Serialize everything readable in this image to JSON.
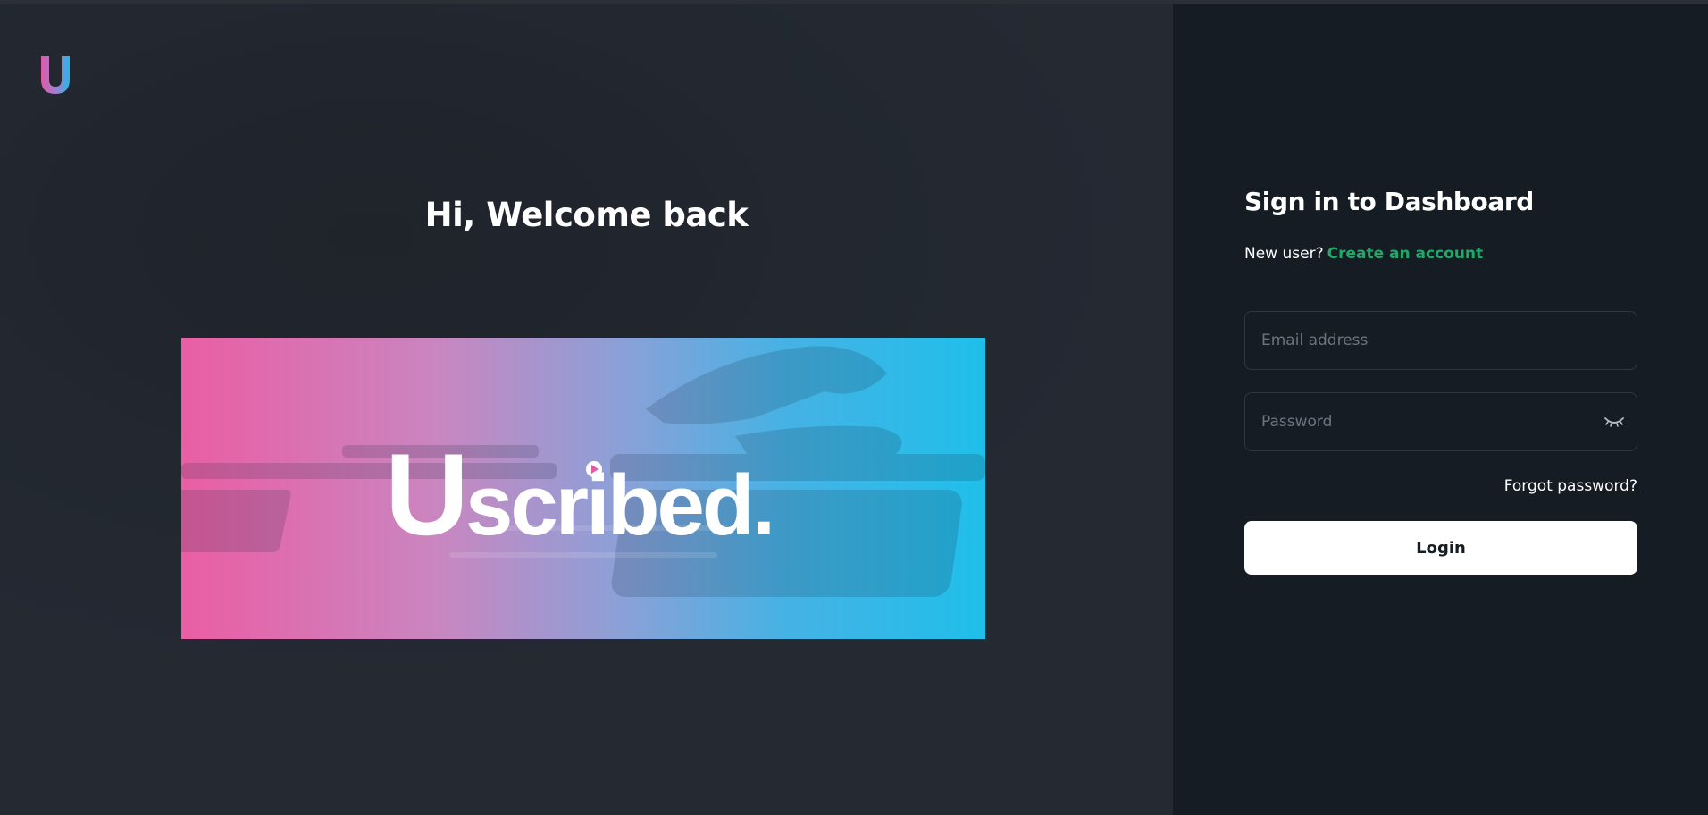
{
  "brand": {
    "name": "Uscribed.",
    "logo_letter": "U",
    "colors": {
      "pink": "#ea5ea4",
      "blue": "#1fbfea",
      "accent_green": "#1fa968",
      "panel_dark": "#161c24",
      "panel_left": "#222730"
    }
  },
  "left": {
    "welcome_title": "Hi, Welcome back"
  },
  "signin": {
    "title": "Sign in to Dashboard",
    "new_user_text": "New user?",
    "create_account_link": "Create an account",
    "email_placeholder": "Email address",
    "password_placeholder": "Password",
    "password_toggle_icon": "eye-closed-icon",
    "forgot_password": "Forgot password?",
    "login_button": "Login"
  }
}
